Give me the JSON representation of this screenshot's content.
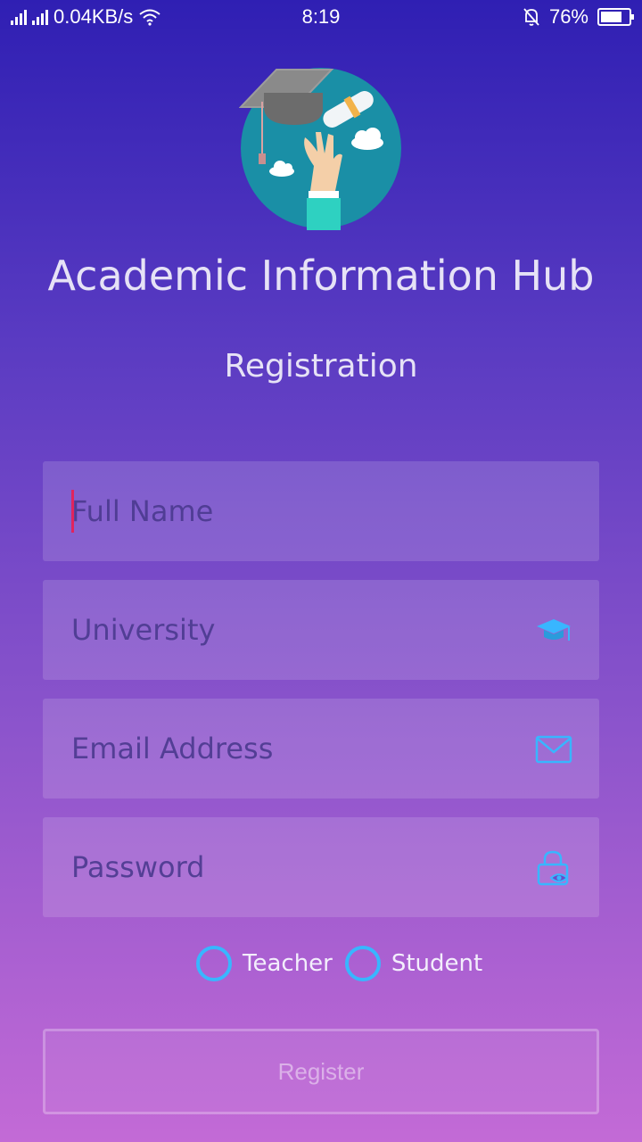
{
  "status_bar": {
    "network_speed": "0.04KB/s",
    "time": "8:19",
    "battery_percent": "76%",
    "battery_level": 0.76
  },
  "app": {
    "title": "Academic Information Hub",
    "subtitle": "Registration"
  },
  "form": {
    "full_name": {
      "placeholder": "Full Name",
      "value": ""
    },
    "university": {
      "placeholder": "University",
      "value": "",
      "icon": "graduation-cap-icon"
    },
    "email": {
      "placeholder": "Email Address",
      "value": "",
      "icon": "envelope-icon"
    },
    "password": {
      "placeholder": "Password",
      "value": "",
      "icon": "lock-eye-icon"
    }
  },
  "roles": [
    {
      "label": "Teacher",
      "selected": false
    },
    {
      "label": "Student",
      "selected": false
    }
  ],
  "register_label": "Register",
  "colors": {
    "accent": "#38b6ff",
    "caret": "#e0245e",
    "gradient_top": "#2f1fb3",
    "gradient_bottom": "#c36ad6"
  }
}
